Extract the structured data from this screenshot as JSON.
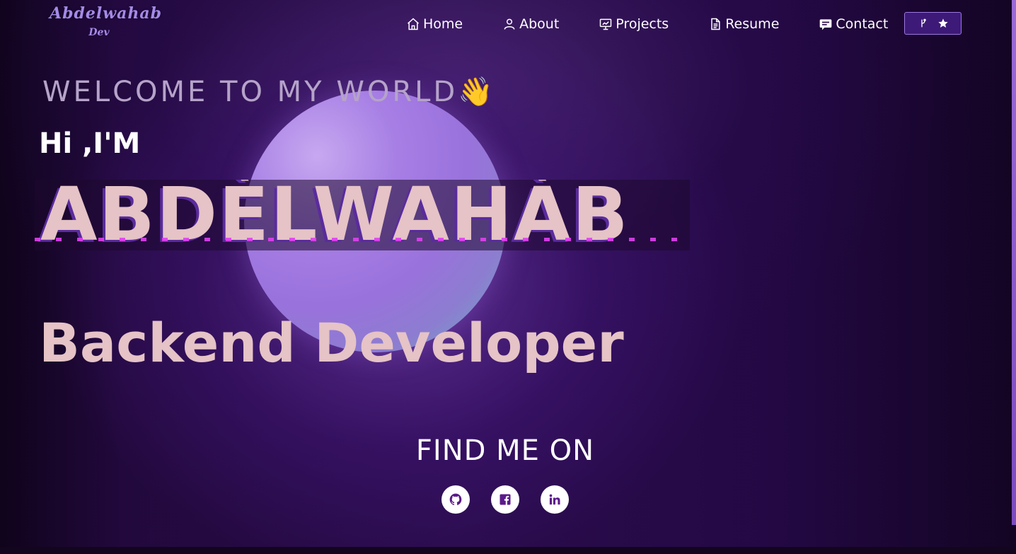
{
  "logo": {
    "main": "Abdelwahab",
    "sub": "Dev"
  },
  "nav": {
    "items": [
      {
        "label": "Home",
        "icon": "home-icon"
      },
      {
        "label": "About",
        "icon": "user-icon"
      },
      {
        "label": "Projects",
        "icon": "presentation-icon"
      },
      {
        "label": "Resume",
        "icon": "document-icon"
      },
      {
        "label": "Contact",
        "icon": "message-icon"
      }
    ],
    "fork_button": {
      "icons": [
        "git-fork-icon",
        "star-icon"
      ]
    }
  },
  "hero": {
    "welcome": "WELCOME TO MY WORLD",
    "wave": "👋",
    "greeting": "Hi ,I'M",
    "name": "ABDÈLWAHÀB",
    "role": "Backend Developer"
  },
  "social": {
    "title": "FIND ME ON",
    "links": [
      {
        "name": "GitHub",
        "icon": "github-icon"
      },
      {
        "name": "Facebook",
        "icon": "facebook-icon"
      },
      {
        "name": "LinkedIn",
        "icon": "linkedin-icon"
      }
    ]
  },
  "colors": {
    "accent": "#3e1a78",
    "name_text": "#e5c3c6",
    "logo": "#a48ae8",
    "social_icon": "#5b1a8a"
  }
}
